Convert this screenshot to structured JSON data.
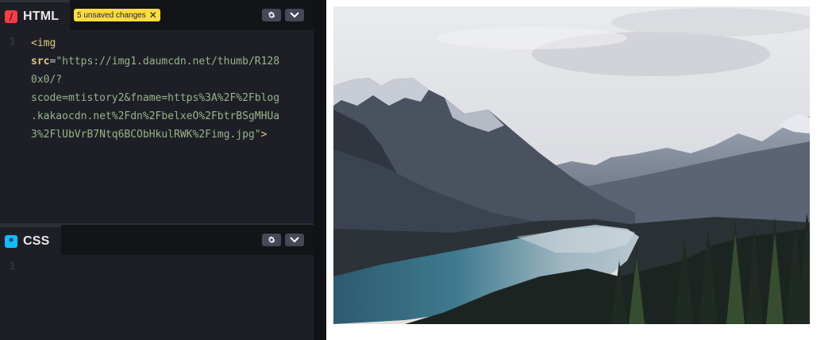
{
  "html_pane": {
    "label": "HTML",
    "icon": "html-slash-icon",
    "icon_glyph": "/",
    "icon_color": "#ff3c41",
    "badge_text": "5 unsaved changes",
    "badge_close": "✕",
    "line_numbers": [
      "1"
    ],
    "code": {
      "open": "<img",
      "attr_name": "src",
      "eq": "=",
      "url_lines": [
        "\"https://img1.daumcdn.net/thumb/R128",
        "0x0/?",
        "scode=mtistory2&fname=https%3A%2F%2Fblog",
        ".kakaocdn.net%2Fdn%2FbelxeO%2FbtrBSgMHUa",
        "3%2FlUbVrB7Ntq6BCObHkulRWK%2Fimg.jpg\""
      ],
      "close": ">"
    }
  },
  "css_pane": {
    "label": "CSS",
    "icon": "css-asterisk-icon",
    "icon_glyph": "*",
    "icon_color": "#0ebeff",
    "line_numbers": [
      "1"
    ]
  },
  "buttons": {
    "settings_icon": "gear-icon",
    "dropdown_icon": "chevron-down-icon"
  },
  "result": {
    "image_alt": "mountain-lake-landscape"
  }
}
